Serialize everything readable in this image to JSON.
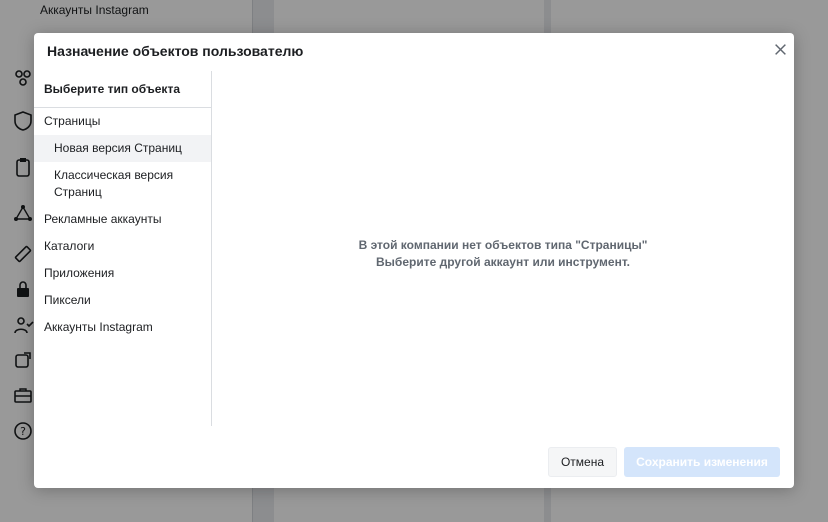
{
  "background": {
    "nav_label": "Аккаунты Instagram",
    "nav_icons": [
      "people-icon",
      "shield-icon",
      "clipboard-icon",
      "network-icon",
      "ruler-icon",
      "lock-icon",
      "person-check-icon",
      "folder-icon",
      "briefcase-icon",
      "help-icon"
    ]
  },
  "modal": {
    "title": "Назначение объектов пользователю",
    "close_label": "×",
    "sidebar": {
      "heading": "Выберите тип объекта",
      "items": [
        {
          "label": "Страницы"
        },
        {
          "label": "Новая версия Страниц",
          "active": true
        },
        {
          "label": "Классическая версия Страниц"
        },
        {
          "label": "Рекламные аккаунты"
        },
        {
          "label": "Каталоги"
        },
        {
          "label": "Приложения"
        },
        {
          "label": "Пиксели"
        },
        {
          "label": "Аккаунты Instagram"
        }
      ]
    },
    "empty_state": {
      "line1": "В этой компании нет объектов типа \"Страницы\"",
      "line2": "Выберите другой аккаунт или инструмент."
    },
    "footer": {
      "cancel_label": "Отмена",
      "save_label": "Сохранить изменения"
    }
  },
  "colors": {
    "save_disabled": "#d4e5fb",
    "overlay": "rgba(0,0,0,0.4)",
    "active_item": "#f2f3f5"
  }
}
